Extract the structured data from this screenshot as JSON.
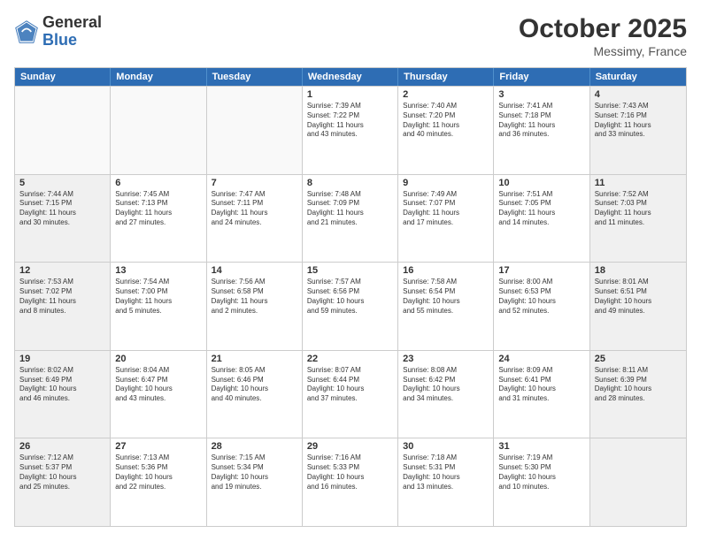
{
  "header": {
    "logo_general": "General",
    "logo_blue": "Blue",
    "month_title": "October 2025",
    "location": "Messimy, France"
  },
  "weekdays": [
    "Sunday",
    "Monday",
    "Tuesday",
    "Wednesday",
    "Thursday",
    "Friday",
    "Saturday"
  ],
  "rows": [
    [
      {
        "day": "",
        "empty": true
      },
      {
        "day": "",
        "empty": true
      },
      {
        "day": "",
        "empty": true
      },
      {
        "day": "1",
        "lines": [
          "Sunrise: 7:39 AM",
          "Sunset: 7:22 PM",
          "Daylight: 11 hours",
          "and 43 minutes."
        ]
      },
      {
        "day": "2",
        "lines": [
          "Sunrise: 7:40 AM",
          "Sunset: 7:20 PM",
          "Daylight: 11 hours",
          "and 40 minutes."
        ]
      },
      {
        "day": "3",
        "lines": [
          "Sunrise: 7:41 AM",
          "Sunset: 7:18 PM",
          "Daylight: 11 hours",
          "and 36 minutes."
        ]
      },
      {
        "day": "4",
        "shaded": true,
        "lines": [
          "Sunrise: 7:43 AM",
          "Sunset: 7:16 PM",
          "Daylight: 11 hours",
          "and 33 minutes."
        ]
      }
    ],
    [
      {
        "day": "5",
        "shaded": true,
        "lines": [
          "Sunrise: 7:44 AM",
          "Sunset: 7:15 PM",
          "Daylight: 11 hours",
          "and 30 minutes."
        ]
      },
      {
        "day": "6",
        "lines": [
          "Sunrise: 7:45 AM",
          "Sunset: 7:13 PM",
          "Daylight: 11 hours",
          "and 27 minutes."
        ]
      },
      {
        "day": "7",
        "lines": [
          "Sunrise: 7:47 AM",
          "Sunset: 7:11 PM",
          "Daylight: 11 hours",
          "and 24 minutes."
        ]
      },
      {
        "day": "8",
        "lines": [
          "Sunrise: 7:48 AM",
          "Sunset: 7:09 PM",
          "Daylight: 11 hours",
          "and 21 minutes."
        ]
      },
      {
        "day": "9",
        "lines": [
          "Sunrise: 7:49 AM",
          "Sunset: 7:07 PM",
          "Daylight: 11 hours",
          "and 17 minutes."
        ]
      },
      {
        "day": "10",
        "lines": [
          "Sunrise: 7:51 AM",
          "Sunset: 7:05 PM",
          "Daylight: 11 hours",
          "and 14 minutes."
        ]
      },
      {
        "day": "11",
        "shaded": true,
        "lines": [
          "Sunrise: 7:52 AM",
          "Sunset: 7:03 PM",
          "Daylight: 11 hours",
          "and 11 minutes."
        ]
      }
    ],
    [
      {
        "day": "12",
        "shaded": true,
        "lines": [
          "Sunrise: 7:53 AM",
          "Sunset: 7:02 PM",
          "Daylight: 11 hours",
          "and 8 minutes."
        ]
      },
      {
        "day": "13",
        "lines": [
          "Sunrise: 7:54 AM",
          "Sunset: 7:00 PM",
          "Daylight: 11 hours",
          "and 5 minutes."
        ]
      },
      {
        "day": "14",
        "lines": [
          "Sunrise: 7:56 AM",
          "Sunset: 6:58 PM",
          "Daylight: 11 hours",
          "and 2 minutes."
        ]
      },
      {
        "day": "15",
        "lines": [
          "Sunrise: 7:57 AM",
          "Sunset: 6:56 PM",
          "Daylight: 10 hours",
          "and 59 minutes."
        ]
      },
      {
        "day": "16",
        "lines": [
          "Sunrise: 7:58 AM",
          "Sunset: 6:54 PM",
          "Daylight: 10 hours",
          "and 55 minutes."
        ]
      },
      {
        "day": "17",
        "lines": [
          "Sunrise: 8:00 AM",
          "Sunset: 6:53 PM",
          "Daylight: 10 hours",
          "and 52 minutes."
        ]
      },
      {
        "day": "18",
        "shaded": true,
        "lines": [
          "Sunrise: 8:01 AM",
          "Sunset: 6:51 PM",
          "Daylight: 10 hours",
          "and 49 minutes."
        ]
      }
    ],
    [
      {
        "day": "19",
        "shaded": true,
        "lines": [
          "Sunrise: 8:02 AM",
          "Sunset: 6:49 PM",
          "Daylight: 10 hours",
          "and 46 minutes."
        ]
      },
      {
        "day": "20",
        "lines": [
          "Sunrise: 8:04 AM",
          "Sunset: 6:47 PM",
          "Daylight: 10 hours",
          "and 43 minutes."
        ]
      },
      {
        "day": "21",
        "lines": [
          "Sunrise: 8:05 AM",
          "Sunset: 6:46 PM",
          "Daylight: 10 hours",
          "and 40 minutes."
        ]
      },
      {
        "day": "22",
        "lines": [
          "Sunrise: 8:07 AM",
          "Sunset: 6:44 PM",
          "Daylight: 10 hours",
          "and 37 minutes."
        ]
      },
      {
        "day": "23",
        "lines": [
          "Sunrise: 8:08 AM",
          "Sunset: 6:42 PM",
          "Daylight: 10 hours",
          "and 34 minutes."
        ]
      },
      {
        "day": "24",
        "lines": [
          "Sunrise: 8:09 AM",
          "Sunset: 6:41 PM",
          "Daylight: 10 hours",
          "and 31 minutes."
        ]
      },
      {
        "day": "25",
        "shaded": true,
        "lines": [
          "Sunrise: 8:11 AM",
          "Sunset: 6:39 PM",
          "Daylight: 10 hours",
          "and 28 minutes."
        ]
      }
    ],
    [
      {
        "day": "26",
        "shaded": true,
        "lines": [
          "Sunrise: 7:12 AM",
          "Sunset: 5:37 PM",
          "Daylight: 10 hours",
          "and 25 minutes."
        ]
      },
      {
        "day": "27",
        "lines": [
          "Sunrise: 7:13 AM",
          "Sunset: 5:36 PM",
          "Daylight: 10 hours",
          "and 22 minutes."
        ]
      },
      {
        "day": "28",
        "lines": [
          "Sunrise: 7:15 AM",
          "Sunset: 5:34 PM",
          "Daylight: 10 hours",
          "and 19 minutes."
        ]
      },
      {
        "day": "29",
        "lines": [
          "Sunrise: 7:16 AM",
          "Sunset: 5:33 PM",
          "Daylight: 10 hours",
          "and 16 minutes."
        ]
      },
      {
        "day": "30",
        "lines": [
          "Sunrise: 7:18 AM",
          "Sunset: 5:31 PM",
          "Daylight: 10 hours",
          "and 13 minutes."
        ]
      },
      {
        "day": "31",
        "lines": [
          "Sunrise: 7:19 AM",
          "Sunset: 5:30 PM",
          "Daylight: 10 hours",
          "and 10 minutes."
        ]
      },
      {
        "day": "",
        "empty": true,
        "shaded": true
      }
    ]
  ]
}
